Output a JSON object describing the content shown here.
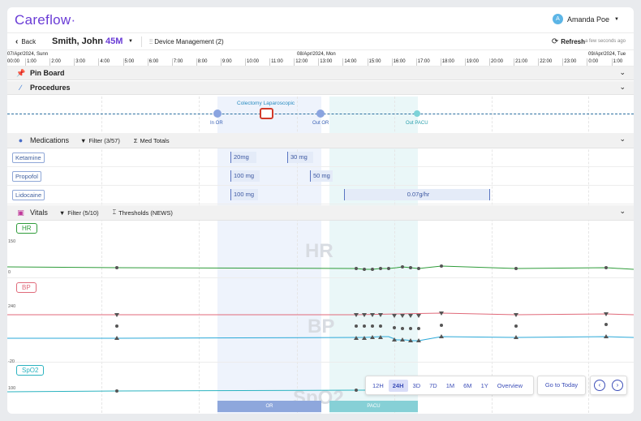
{
  "app": {
    "logo": "Careflow",
    "logo_dot": "·"
  },
  "user": {
    "initial": "A",
    "name": "Amanda Poe"
  },
  "subbar": {
    "back_label": "Back",
    "patient_name": "Smith, John",
    "patient_age": "45M",
    "device_label": "Device Management (2)",
    "refresh_label": "Refresh",
    "refresh_time": "a few seconds ago"
  },
  "timeline": {
    "dates": [
      "07/Apr/2024, Sunn",
      "08/Apr/2024, Mon",
      "09/Apr/2024, Tue"
    ],
    "hours": [
      "00:00",
      "1:00",
      "2:00",
      "3:00",
      "4:00",
      "5:00",
      "6:00",
      "7:00",
      "8:00",
      "9:00",
      "10:00",
      "11:00",
      "12:00",
      "13:00",
      "14:00",
      "15:00",
      "16:00",
      "17:00",
      "18:00",
      "19:00",
      "20:00",
      "21:00",
      "22:00",
      "23:00",
      "0:00",
      "1:00"
    ]
  },
  "sections": {
    "pinboard": "Pin Board",
    "procedures": "Procedures",
    "medications": "Medications",
    "med_filter": "Filter (3/57)",
    "med_totals": "Med Totals",
    "vitals": "Vitals",
    "vitals_filter": "Filter (5/10)",
    "vitals_thresholds": "Thresholds (NEWS)"
  },
  "procedure": {
    "name": "Colectomy Laparoscopic",
    "events": [
      "In OR",
      "Out OR",
      "Out PACU"
    ]
  },
  "medications": [
    {
      "name": "Ketamine",
      "doses": [
        "20mg",
        "30 mg"
      ]
    },
    {
      "name": "Propofol",
      "doses": [
        "100 mg",
        "50 mg"
      ]
    },
    {
      "name": "Lidocaine",
      "doses": [
        "100 mg",
        "0.07g/hr"
      ]
    }
  ],
  "vitals": [
    {
      "tag": "HR",
      "watermark": "HR",
      "ymax": "150",
      "ymin": "0",
      "color": "#2f9c3a"
    },
    {
      "tag": "BP",
      "watermark": "BP",
      "ymax": "240",
      "ymin": "-20",
      "color": "#e06a7a"
    },
    {
      "tag": "SpO2",
      "watermark": "SpO2",
      "ymax": "100",
      "ymin": "",
      "color": "#2bb3c0"
    }
  ],
  "phases": {
    "or": "OR",
    "pacu": "PACU",
    "or_color": "#8ea7dc",
    "pacu_color": "#86d0d6"
  },
  "range": {
    "options": [
      "12H",
      "24H",
      "3D",
      "7D",
      "1M",
      "6M",
      "1Y",
      "Overview"
    ],
    "selected": "24H",
    "goto": "Go to Today"
  },
  "colors": {
    "accent": "#6a3cd6",
    "link": "#3d4fb8"
  }
}
